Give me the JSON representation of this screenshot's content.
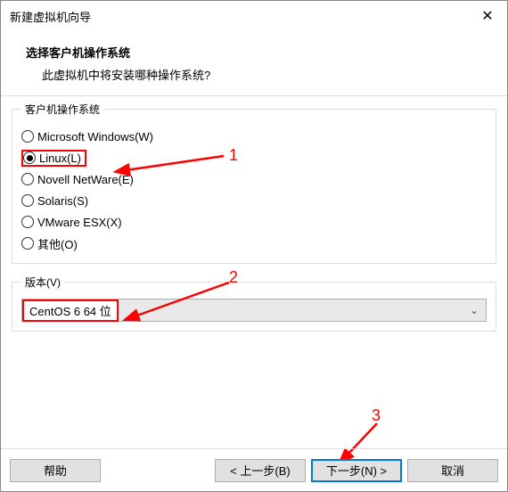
{
  "titlebar": {
    "title": "新建虚拟机向导"
  },
  "header": {
    "title": "选择客户机操作系统",
    "subtitle": "此虚拟机中将安装哪种操作系统?"
  },
  "osGroup": {
    "legend": "客户机操作系统",
    "options": [
      {
        "label": "Microsoft Windows(W)",
        "selected": false
      },
      {
        "label": "Linux(L)",
        "selected": true
      },
      {
        "label": "Novell NetWare(E)",
        "selected": false
      },
      {
        "label": "Solaris(S)",
        "selected": false
      },
      {
        "label": "VMware ESX(X)",
        "selected": false
      },
      {
        "label": "其他(O)",
        "selected": false
      }
    ]
  },
  "versionGroup": {
    "legend": "版本(V)",
    "selected": "CentOS 6 64 位"
  },
  "annotations": {
    "one": "1",
    "two": "2",
    "three": "3",
    "color": "#ff0000"
  },
  "footer": {
    "help": "帮助",
    "back": "< 上一步(B)",
    "next": "下一步(N) >",
    "cancel": "取消"
  }
}
